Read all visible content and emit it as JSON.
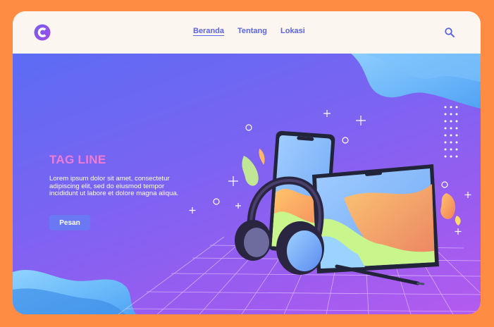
{
  "nav": {
    "logo_icon": "c-logo-icon",
    "links": [
      {
        "label": "Beranda",
        "active": true
      },
      {
        "label": "Tentang",
        "active": false
      },
      {
        "label": "Lokasi",
        "active": false
      }
    ],
    "search_icon": "search-icon"
  },
  "hero": {
    "tagline": "TAG LINE",
    "description": "Lorem ipsum dolor sit amet, consectetur adipiscing elit, sed do eiusmod tempor incididunt ut labore et dolore magna aliqua.",
    "cta_label": "Pesan"
  },
  "colors": {
    "frame": "#FF8C42",
    "navbar": "#FBF6EF",
    "accent": "#5B63E6",
    "tagline": "#F07BD6",
    "button": "#6A79F3"
  }
}
